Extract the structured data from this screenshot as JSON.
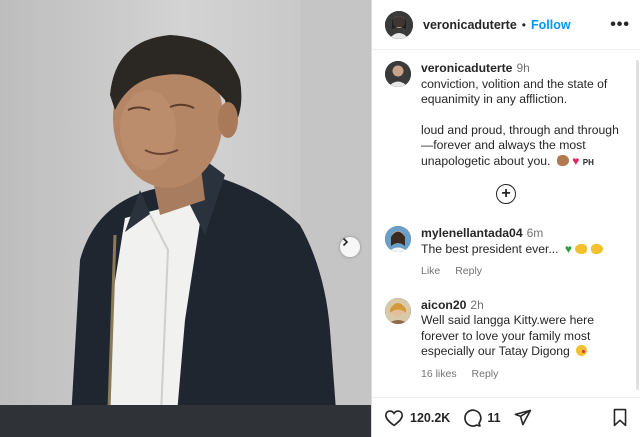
{
  "post": {
    "username": "veronicaduterte",
    "follow_label": "Follow",
    "separator": "•",
    "more_label": "•••"
  },
  "caption": {
    "username": "veronicaduterte",
    "time": "9h",
    "paragraph1": "conviction, volition and the state of equanimity in any affliction.",
    "paragraph2": "loud and proud, through and through—forever and always the most unapologetic about you.",
    "emoji_tail": "PH"
  },
  "comments": [
    {
      "username": "mylenellantada04",
      "time": "6m",
      "text": "The best president ever...",
      "likes_label": "",
      "like_label": "Like",
      "reply_label": "Reply"
    },
    {
      "username": "aicon20",
      "time": "2h",
      "text": "Well said langga Kitty.were here forever to love your family most especially our Tatay Digong",
      "likes_label": "16 likes",
      "like_label": "",
      "reply_label": "Reply"
    }
  ],
  "actions": {
    "likes_count": "120.2K",
    "comments_count": "11"
  },
  "icons": {
    "next": "chevron-right-icon",
    "add": "plus-circle-icon",
    "like": "heart-icon",
    "comment": "comment-icon",
    "share": "send-icon",
    "save": "bookmark-icon"
  },
  "colors": {
    "follow": "#0095f6",
    "heart": "#e0245e"
  }
}
